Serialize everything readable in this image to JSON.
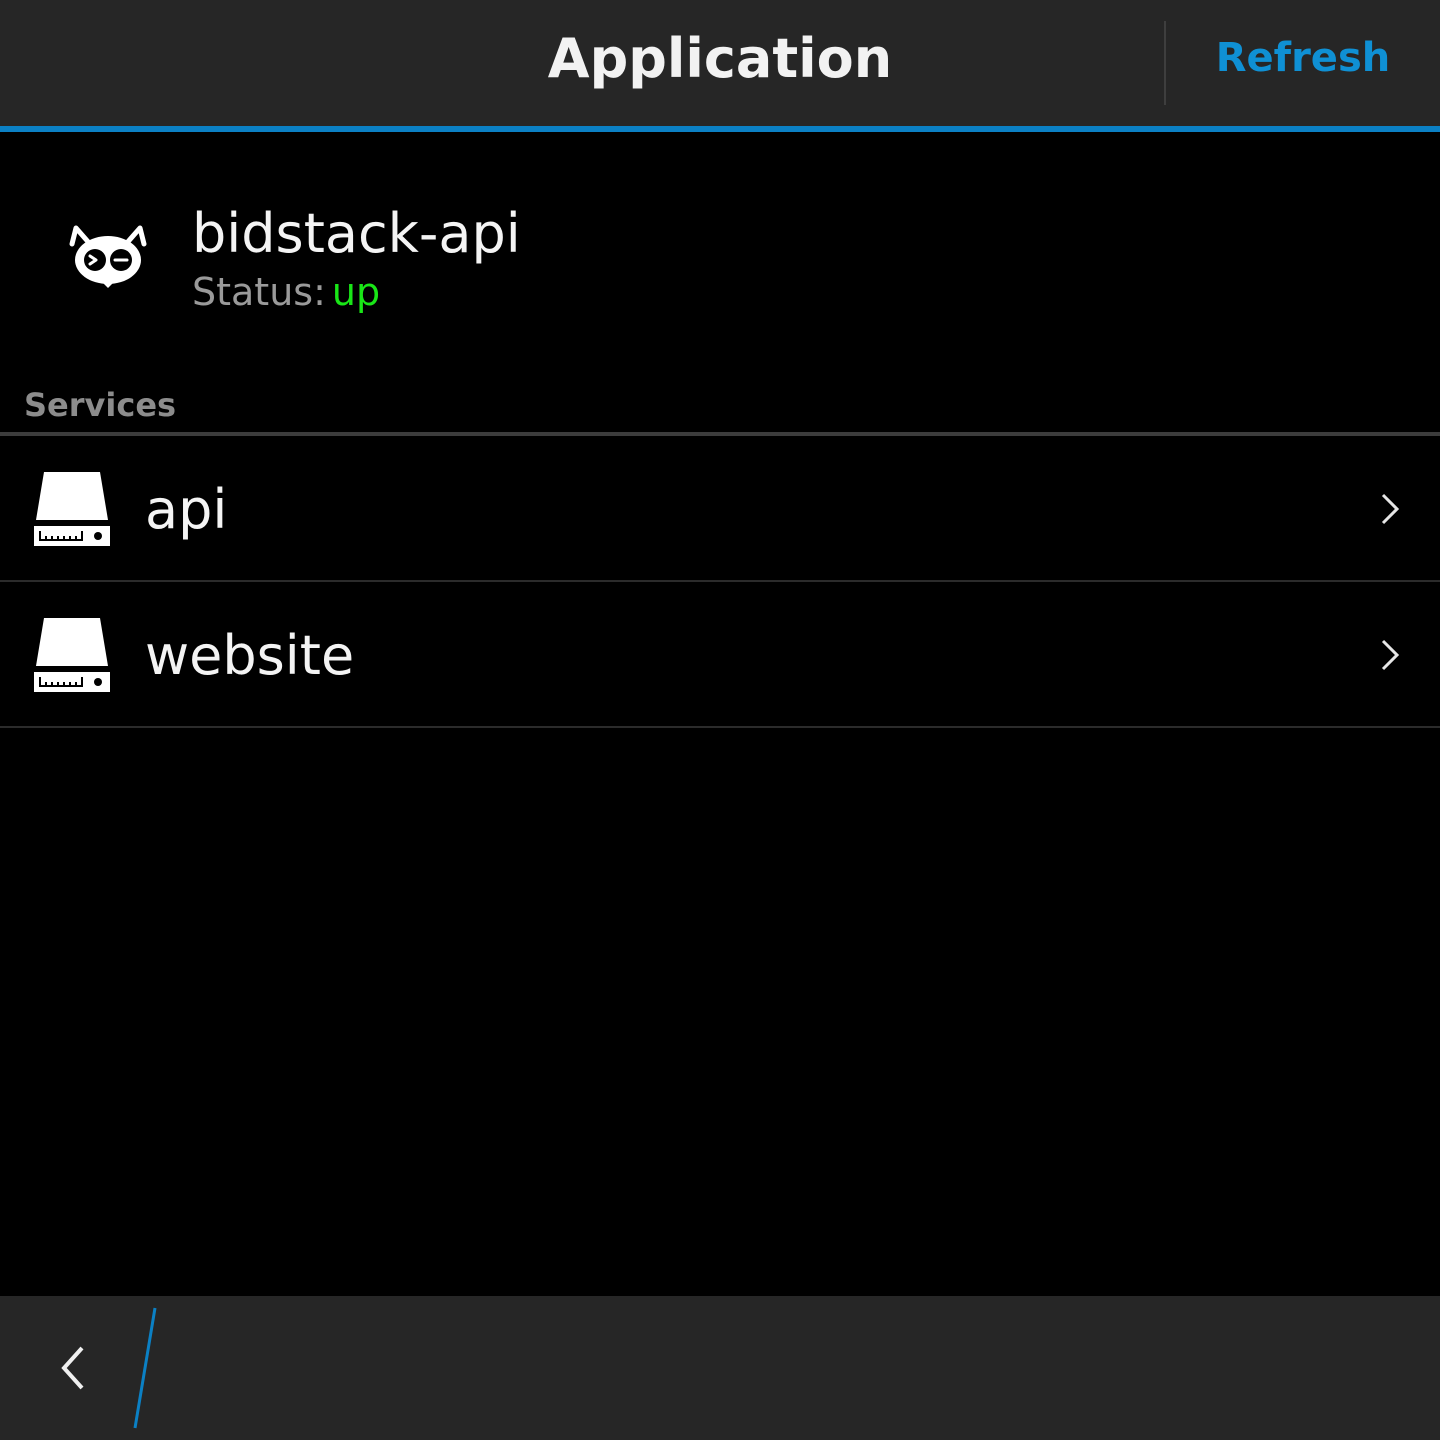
{
  "header": {
    "title": "Application",
    "refresh_label": "Refresh"
  },
  "app": {
    "name": "bidstack-api",
    "status_label": "Status:",
    "status_value": "up",
    "logo_icon": "ant-mascot-icon"
  },
  "services": {
    "section_label": "Services",
    "items": [
      {
        "name": "api",
        "icon": "server-drive-icon"
      },
      {
        "name": "website",
        "icon": "server-drive-icon"
      }
    ]
  },
  "actionbar": {
    "back_icon": "back-chevron-icon"
  },
  "colors": {
    "accent": "#0b80c4",
    "refresh": "#0f90d4",
    "status_up": "#19e617",
    "bar_background": "#262626"
  }
}
